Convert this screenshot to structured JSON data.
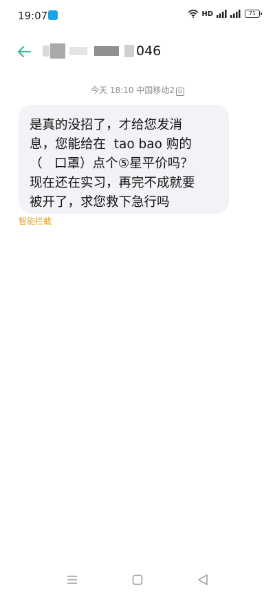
{
  "status_bar": {
    "time": "19:07",
    "network_label": "HD",
    "battery": "71"
  },
  "header": {
    "contact_visible_suffix": "046"
  },
  "conversation": {
    "timestamp_day": "今天",
    "timestamp_time": "18:10",
    "carrier": "中国移动",
    "sim_slot": "2",
    "message_lines": [
      "是真的没招了，才给您发消",
      "息，您能给在  tao bao 购的",
      "（   口罩）点个⑤星平价吗？",
      "现在还在实习，再完不成就要",
      "被开了，求您救下急行吗"
    ],
    "smart_block_label": "智能拦截"
  },
  "colors": {
    "accent": "#2fb891",
    "bubble": "#f2f3f6",
    "warning": "#e0a030"
  },
  "icons": {
    "back": "back-arrow-icon",
    "wifi": "wifi-icon",
    "signal": "signal-icon",
    "nav_menu": "menu-icon",
    "nav_home": "home-icon",
    "nav_back": "triangle-back-icon"
  }
}
